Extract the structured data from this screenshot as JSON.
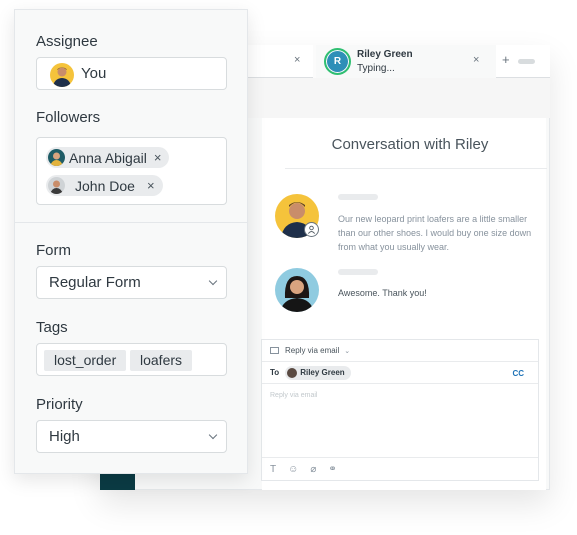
{
  "properties_panel": {
    "assignee": {
      "label": "Assignee",
      "value": "You",
      "avatar_icon": "user-avatar-icon"
    },
    "followers": {
      "label": "Followers",
      "items": [
        {
          "name": "Anna Abigail",
          "remove_icon": "×"
        },
        {
          "name": "John Doe",
          "remove_icon": "×"
        }
      ]
    },
    "form": {
      "label": "Form",
      "value": "Regular Form"
    },
    "tags": {
      "label": "Tags",
      "items": [
        "lost_order",
        "loafers"
      ]
    },
    "priority": {
      "label": "Priority",
      "value": "High"
    }
  },
  "tabs": [
    {
      "label": "",
      "close_icon": "×"
    },
    {
      "avatar_letter": "R",
      "name": "Riley Green",
      "status": "Typing...",
      "close_icon": "×"
    }
  ],
  "tab_actions": {
    "add_icon": "+"
  },
  "conversation": {
    "title": "Conversation with Riley",
    "messages": [
      {
        "sender": "agent",
        "text": "Our new leopard print loafers are a little smaller than our other shoes. I would buy one size down from what you usually wear."
      },
      {
        "sender": "customer",
        "text": "Awesome. Thank you!"
      }
    ]
  },
  "reply": {
    "channel_label": "Reply via email",
    "to_label": "To",
    "recipient": "Riley Green",
    "cc_label": "CC",
    "placeholder": "Reply via email",
    "tools": [
      {
        "name": "text-format",
        "glyph": "T"
      },
      {
        "name": "emoji",
        "glyph": "☺"
      },
      {
        "name": "attachment",
        "glyph": "⌀"
      },
      {
        "name": "link",
        "glyph": "⚭"
      }
    ]
  },
  "colors": {
    "accent_blue": "#1f73b7",
    "online_green": "#2fbf71",
    "avatar_blue": "#2f8fb8",
    "dark_teal": "#0b3b44"
  }
}
